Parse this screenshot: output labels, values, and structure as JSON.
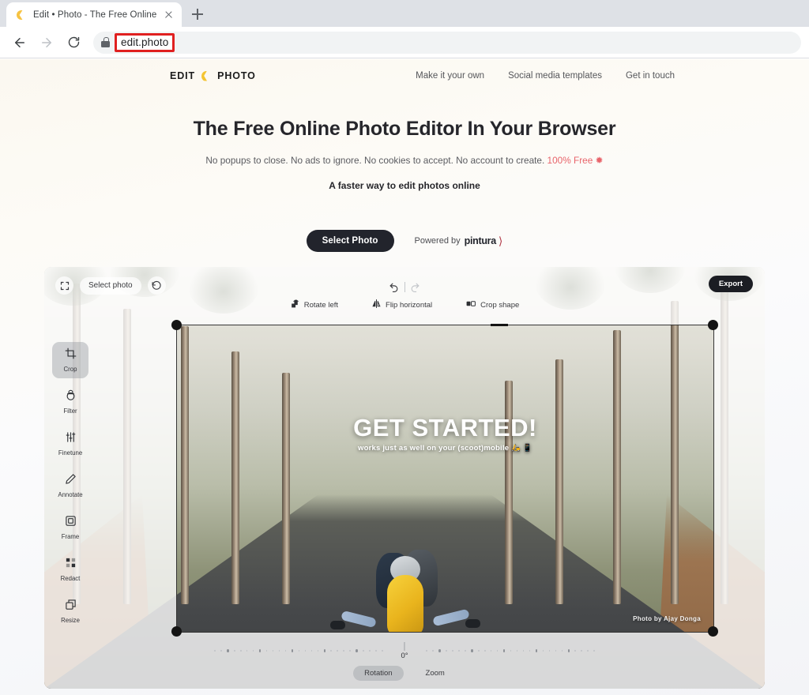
{
  "browser": {
    "tab_title": "Edit • Photo - The Free Online Ph",
    "favicon": "banana-icon",
    "new_tab_label": "+",
    "back_icon": "back-arrow-icon",
    "forward_icon": "forward-arrow-icon",
    "reload_icon": "reload-icon",
    "lock_icon": "lock-icon",
    "url": "edit.photo",
    "url_highlight_color": "#e02020"
  },
  "site": {
    "logo": {
      "left": "EDIT",
      "icon": "banana-icon",
      "right": "PHOTO"
    },
    "nav": [
      {
        "label": "Make it your own"
      },
      {
        "label": "Social media templates"
      },
      {
        "label": "Get in touch"
      }
    ]
  },
  "hero": {
    "title": "The Free Online Photo Editor In Your Browser",
    "subtitle_plain": "No popups to close. No ads to ignore. No cookies to accept. No account to create. ",
    "subtitle_free": "100% Free",
    "subtitle_star": "✹",
    "tagline": "A faster way to edit photos online",
    "cta_label": "Select Photo",
    "powered_prefix": "Powered by",
    "powered_brand": "pintura",
    "powered_swoosh": "⟩",
    "free_color": "#e8646b",
    "cta_bg": "#22242c"
  },
  "editor": {
    "fullscreen_icon": "fullscreen-icon",
    "select_photo_label": "Select photo",
    "revert_icon": "revert-history-icon",
    "export_label": "Export",
    "undo_icon": "undo-icon",
    "redo_icon": "redo-icon",
    "actions": [
      {
        "label": "Rotate left",
        "icon": "rotate-left-icon"
      },
      {
        "label": "Flip horizontal",
        "icon": "flip-horizontal-icon"
      },
      {
        "label": "Crop shape",
        "icon": "crop-shape-icon"
      }
    ],
    "tools": [
      {
        "label": "Crop",
        "icon": "crop-icon",
        "active": true
      },
      {
        "label": "Filter",
        "icon": "filter-icon",
        "active": false
      },
      {
        "label": "Finetune",
        "icon": "finetune-icon",
        "active": false
      },
      {
        "label": "Annotate",
        "icon": "annotate-pen-icon",
        "active": false
      },
      {
        "label": "Frame",
        "icon": "frame-icon",
        "active": false
      },
      {
        "label": "Redact",
        "icon": "redact-icon",
        "active": false
      },
      {
        "label": "Resize",
        "icon": "resize-icon",
        "active": false
      }
    ],
    "rotation": {
      "value": "0°",
      "tabs": [
        {
          "label": "Rotation",
          "active": true
        },
        {
          "label": "Zoom",
          "active": false
        }
      ]
    },
    "photo": {
      "overlay_title": "GET STARTED!",
      "overlay_subtitle": "works just as well on your (scoot)mobile 🛵 📱",
      "credit": "Photo by Ajay Donga"
    }
  }
}
